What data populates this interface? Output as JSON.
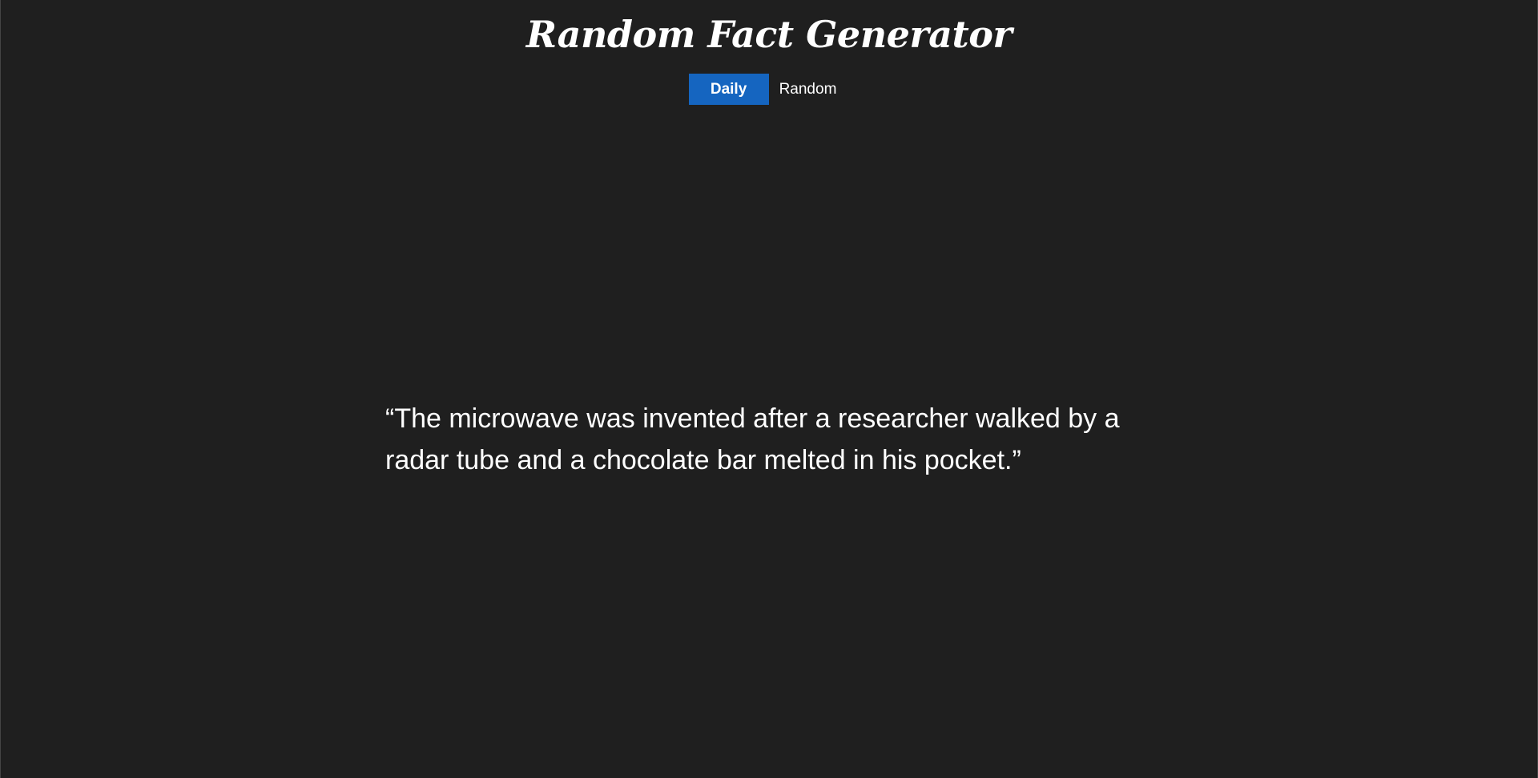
{
  "app": {
    "title": "Random Fact Generator"
  },
  "tabs": [
    {
      "label": "Daily",
      "active": true
    },
    {
      "label": "Random",
      "active": false
    }
  ],
  "fact": {
    "text": "“The microwave was invented after a researcher walked by a radar tube and a chocolate bar melted in his pocket.”"
  },
  "colors": {
    "background": "#1f1f1f",
    "active_tab": "#1565c0",
    "text": "#ffffff"
  }
}
